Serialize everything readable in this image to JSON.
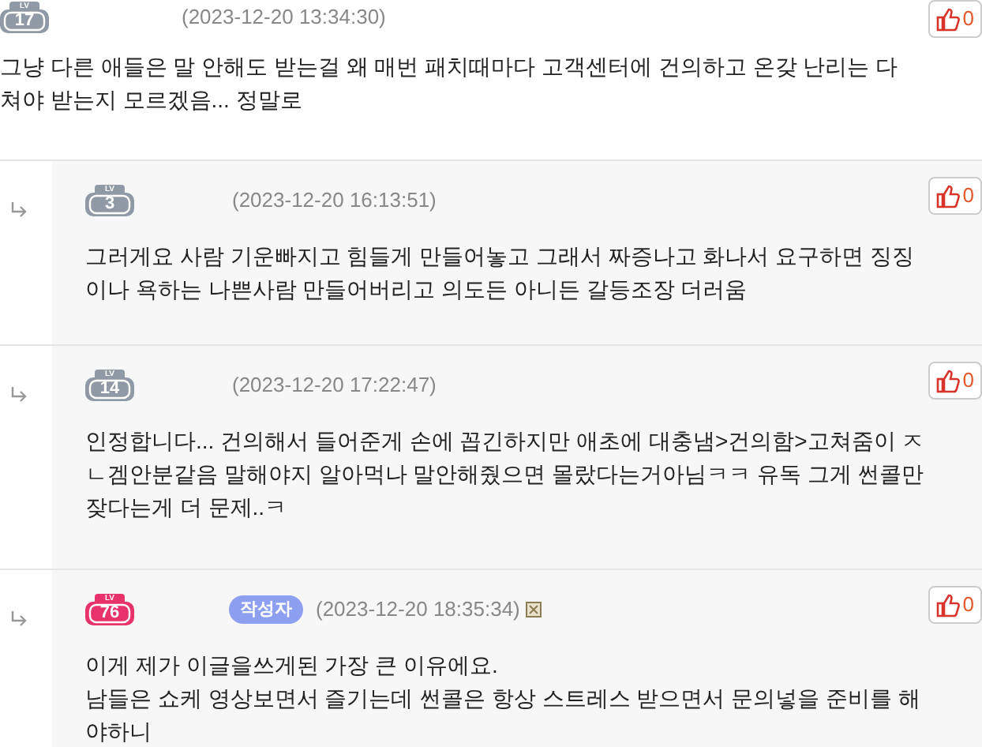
{
  "comments": [
    {
      "reply": false,
      "level_label": "LV",
      "level": "17",
      "color": "#8f9aa6",
      "timestamp": "(2023-12-20 13:34:30)",
      "likes": "0",
      "paragraphs": [
        "그냥 다른 애들은 말 안해도 받는걸 왜 매번 패치때마다 고객센터에 건의하고 온갖 난리는 다 쳐야 받는지 모르겠음... 정말로"
      ]
    },
    {
      "reply": true,
      "level_label": "LV",
      "level": "3",
      "color": "#8f9aa6",
      "timestamp": "(2023-12-20 16:13:51)",
      "likes": "0",
      "paragraphs": [
        "그러게요 사람 기운빠지고 힘들게 만들어놓고 그래서 짜증나고 화나서 요구하면 징징이나 욕하는 나쁜사람 만들어버리고 의도든 아니든 갈등조장 더러움"
      ]
    },
    {
      "reply": true,
      "level_label": "LV",
      "level": "14",
      "color": "#8f9aa6",
      "timestamp": "(2023-12-20 17:22:47)",
      "likes": "0",
      "paragraphs": [
        "인정합니다... 건의해서 들어준게 손에 꼽긴하지만 애초에 대충냄>건의함>고쳐줌이 ㅈㄴ겜안분같음 말해야지 알아먹나 말안해줬으면 몰랐다는거아님ㅋㅋ 유독 그게 썬콜만 잦다는게 더 문제..ㅋ"
      ]
    },
    {
      "reply": true,
      "level_label": "LV",
      "level": "76",
      "color": "#e8336a",
      "author_tag": "작성자",
      "timestamp": "(2023-12-20 18:35:34)",
      "flag": true,
      "likes": "0",
      "paragraphs": [
        "이게 제가 이글을쓰게된 가장 큰 이유에요.",
        "남들은 쇼케 영상보면서 즐기는데 썬콜은 항상 스트레스 받으면서 문의넣을 준비를 해야하니"
      ]
    }
  ]
}
